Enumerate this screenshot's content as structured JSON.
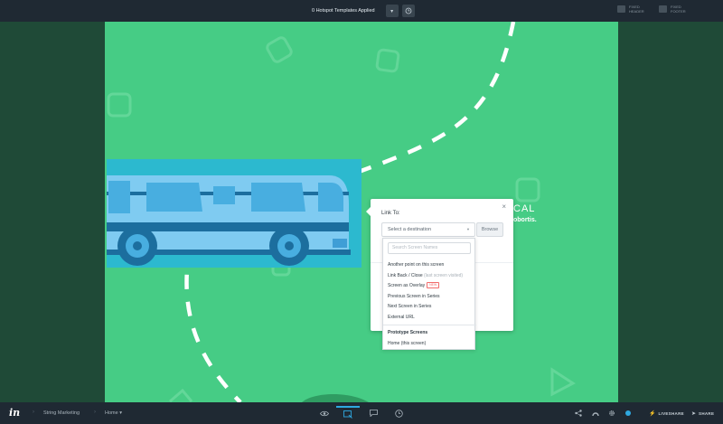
{
  "topbar": {
    "templates_label": "0 Hotspot Templates Applied",
    "fixed_header_line1": "FIXED",
    "fixed_header_line2": "HEADER",
    "fixed_footer_line1": "FIXED",
    "fixed_footer_line2": "FOOTER"
  },
  "canvas": {
    "background_color": "#46cc85",
    "promo_line1": "CAL",
    "promo_line2": "obortis."
  },
  "link_modal": {
    "title": "Link To:",
    "close_glyph": "×",
    "select_placeholder": "Select a destination",
    "browse_label": "Browse"
  },
  "dropdown": {
    "search_placeholder": "Search Screen Names",
    "items": [
      {
        "label": "Another point on this screen"
      },
      {
        "label": "Link Back / Close",
        "hint": "(last screen visited)"
      },
      {
        "label": "Screen as Overlay",
        "badge": "NEW"
      },
      {
        "label": "Previous Screen in Series"
      },
      {
        "label": "Next Screen in Series"
      },
      {
        "label": "External URL"
      }
    ],
    "section_heading": "Prototype Screens",
    "screens": [
      {
        "label": "Home (this screen)"
      }
    ]
  },
  "bottombar": {
    "logo": "in",
    "project": "String Marketing",
    "screen": "Home",
    "liveshare_label": "LIVESHARE",
    "share_label": "SHARE",
    "accent_color": "#2fa8e0"
  }
}
